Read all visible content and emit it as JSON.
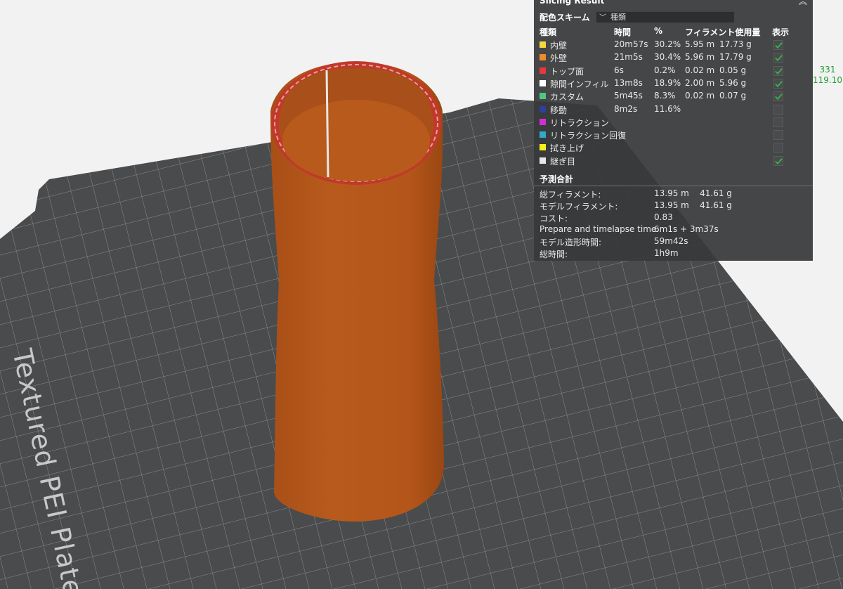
{
  "plate": {
    "label": "Textured PEI Plate"
  },
  "panel": {
    "title": "Slicing Result",
    "scheme_label": "配色スキーム",
    "scheme_value": "種類",
    "headers": {
      "type": "種類",
      "time": "時間",
      "percent": "%",
      "filament": "フィラメント使用量",
      "display": "表示"
    },
    "rows": [
      {
        "name": "内壁",
        "color": "#f6d83a",
        "time": "20m57s",
        "percent": "30.2%",
        "length": "5.95 m",
        "weight": "17.73 g",
        "checked": true,
        "has_checkbox": true
      },
      {
        "name": "外壁",
        "color": "#f08a2c",
        "time": "21m5s",
        "percent": "30.4%",
        "length": "5.96 m",
        "weight": "17.79 g",
        "checked": true,
        "has_checkbox": true
      },
      {
        "name": "トップ面",
        "color": "#e8383c",
        "time": "6s",
        "percent": "0.2%",
        "length": "0.02 m",
        "weight": "0.05 g",
        "checked": true,
        "has_checkbox": true
      },
      {
        "name": "隙間インフィル",
        "color": "#ffffff",
        "time": "13m8s",
        "percent": "18.9%",
        "length": "2.00 m",
        "weight": "5.96 g",
        "checked": true,
        "has_checkbox": true
      },
      {
        "name": "カスタム",
        "color": "#4cc87f",
        "time": "5m45s",
        "percent": "8.3%",
        "length": "0.02 m",
        "weight": "0.07 g",
        "checked": true,
        "has_checkbox": true
      },
      {
        "name": "移動",
        "color": "#303f9f",
        "time": "8m2s",
        "percent": "11.6%",
        "length": "",
        "weight": "",
        "checked": false,
        "has_checkbox": true
      },
      {
        "name": "リトラクション",
        "color": "#d12fd6",
        "time": "",
        "percent": "",
        "length": "",
        "weight": "",
        "checked": false,
        "has_checkbox": true
      },
      {
        "name": "リトラクション回復",
        "color": "#31a9c9",
        "time": "",
        "percent": "",
        "length": "",
        "weight": "",
        "checked": false,
        "has_checkbox": true
      },
      {
        "name": "拭き上げ",
        "color": "#f6f01a",
        "time": "",
        "percent": "",
        "length": "",
        "weight": "",
        "checked": false,
        "has_checkbox": true
      },
      {
        "name": "継ぎ目",
        "color": "#e6e6e6",
        "time": "",
        "percent": "",
        "length": "",
        "weight": "",
        "checked": true,
        "has_checkbox": true
      }
    ],
    "summary_title": "予測合計",
    "summary": [
      {
        "key": "総フィラメント:",
        "value": "13.95 m    41.61 g"
      },
      {
        "key": "モデルフィラメント:",
        "value": "13.95 m    41.61 g"
      },
      {
        "key": "コスト:",
        "value": "0.83"
      },
      {
        "key": "Prepare and timelapse time:",
        "value": "6m1s + 3m37s"
      },
      {
        "key": "モデル造形時間:",
        "value": "59m42s"
      },
      {
        "key": "総時間:",
        "value": "1h9m"
      }
    ]
  },
  "layer_slider": {
    "top_layer": "331",
    "top_height": "119.10"
  },
  "colors": {
    "model": "#b2561b",
    "plate": "#4a4b4c",
    "check": "#38b14a",
    "accent": "#1f9f2f"
  }
}
